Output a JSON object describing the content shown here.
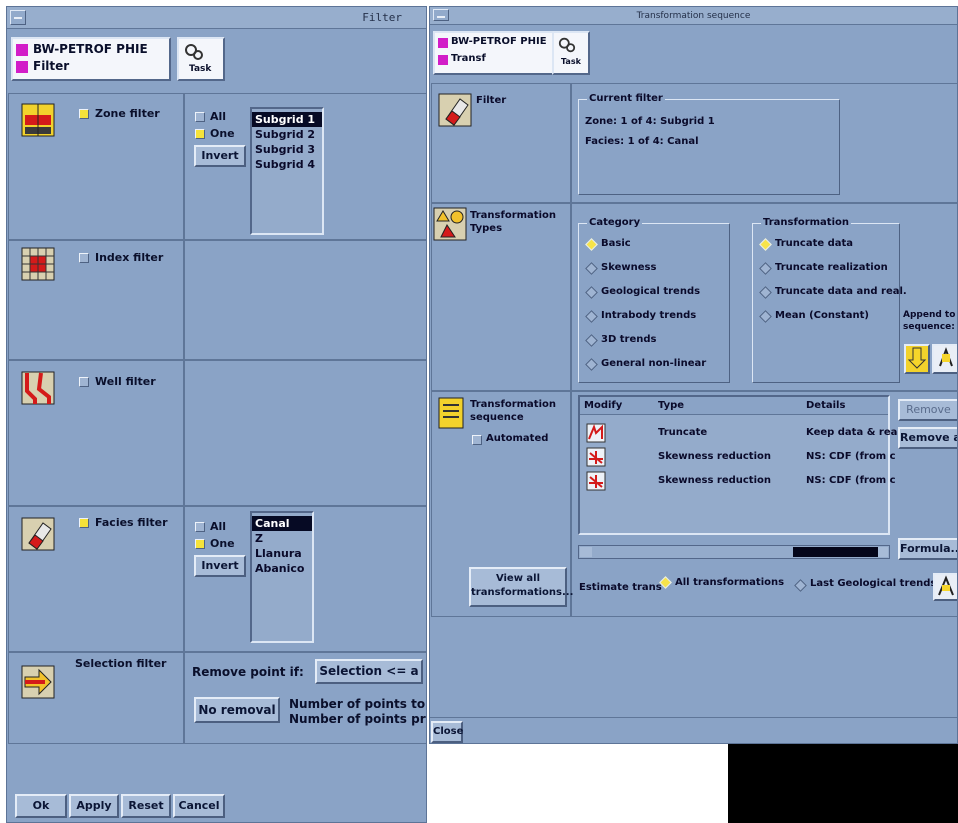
{
  "filter_window": {
    "title": "Filter",
    "project": {
      "name": "BW-PETROF PHIE",
      "item": "Filter"
    },
    "task_label": "Task",
    "zone": {
      "label": "Zone filter",
      "all": "All",
      "one": "One",
      "invert": "Invert",
      "items": [
        "Subgrid 1",
        "Subgrid 2",
        "Subgrid 3",
        "Subgrid 4"
      ]
    },
    "index": {
      "label": "Index filter"
    },
    "well": {
      "label": "Well filter"
    },
    "facies": {
      "label": "Facies filter",
      "all": "All",
      "one": "One",
      "invert": "Invert",
      "items": [
        "Canal",
        "Z",
        "Llanura",
        "Abanico"
      ]
    },
    "selection": {
      "label": "Selection filter",
      "remove_if": "Remove point if:",
      "selection_btn": "Selection <= a",
      "no_removal": "No removal",
      "points1": "Number of points to",
      "points2": "Number of points pr"
    },
    "bottom": {
      "ok": "Ok",
      "apply": "Apply",
      "reset": "Reset",
      "cancel": "Cancel"
    }
  },
  "trans_window": {
    "title": "Transformation sequence",
    "project": {
      "name": "BW-PETROF PHIE",
      "item": "Transf"
    },
    "task_label": "Task",
    "filter": {
      "label": "Filter",
      "group": "Current filter",
      "zone_line": "Zone:   1 of 4: Subgrid 1",
      "facies_line": "Facies: 1 of 4: Canal"
    },
    "types": {
      "label1": "Transformation",
      "label2": "Types",
      "category_title": "Category",
      "categories": [
        "Basic",
        "Skewness",
        "Geological trends",
        "Intrabody trends",
        "3D trends",
        "General non-linear"
      ],
      "transformation_title": "Transformation",
      "transformations": [
        "Truncate data",
        "Truncate realization",
        "Truncate data and real.",
        "Mean (Constant)"
      ],
      "append1": "Append to",
      "append2": "sequence:"
    },
    "sequence": {
      "label1": "Transformation",
      "label2": "sequence",
      "automated": "Automated",
      "headers": {
        "modify": "Modify",
        "type": "Type",
        "details": "Details"
      },
      "rows": [
        {
          "type": "Truncate",
          "details": "Keep data & rea"
        },
        {
          "type": "Skewness reduction",
          "details": "NS: CDF (from c"
        },
        {
          "type": "Skewness reduction",
          "details": "NS: CDF (from c"
        }
      ],
      "remove": "Remove",
      "remove_all": "Remove all",
      "formula": "Formula...",
      "view_all1": "View all",
      "view_all2": "transformations...",
      "estimate": "Estimate trans",
      "all_transformations": "All transformations",
      "last_geological": "Last Geological trends"
    },
    "close": "Close"
  }
}
